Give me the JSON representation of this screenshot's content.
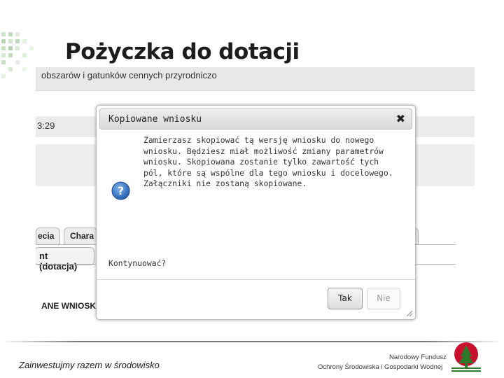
{
  "slide": {
    "title": "Pożyczka do dotacji"
  },
  "app": {
    "header_text": "obszarów i gatunków cennych przyrodniczo",
    "time_text": "3:29",
    "tabs": [
      {
        "label": "ecia"
      },
      {
        "label": "Chara"
      }
    ],
    "subtab_label": "nt (dotacja)",
    "section_text": "ANE WNIOSK"
  },
  "dialog": {
    "title": "Kopiowane wniosku",
    "close_icon": "close-icon",
    "icon": "question-icon",
    "message_lines": [
      "Zamierzasz skopiować tą wersję wniosku do nowego",
      "wniosku. Będziesz miał możliwość zmiany parametrów",
      "wniosku. Skopiowana zostanie tylko zawartość tych",
      "pól, które są wspólne dla tego wniosku i docelowego.",
      "Załączniki nie zostaną skopiowane."
    ],
    "question": "Kontynuować?",
    "yes_label": "Tak",
    "no_label": "Nie"
  },
  "footer": {
    "slogan": "Zainwestujmy razem w środowisko",
    "fund_line1": "Narodowy Fundusz",
    "fund_line2": "Ochrony Środowiska i Gospodarki Wodnej"
  },
  "colors": {
    "dialog_header": "#dddddd",
    "question_icon": "#2a64b5",
    "logo_red": "#c8102e",
    "logo_green": "#2a7a2a"
  }
}
